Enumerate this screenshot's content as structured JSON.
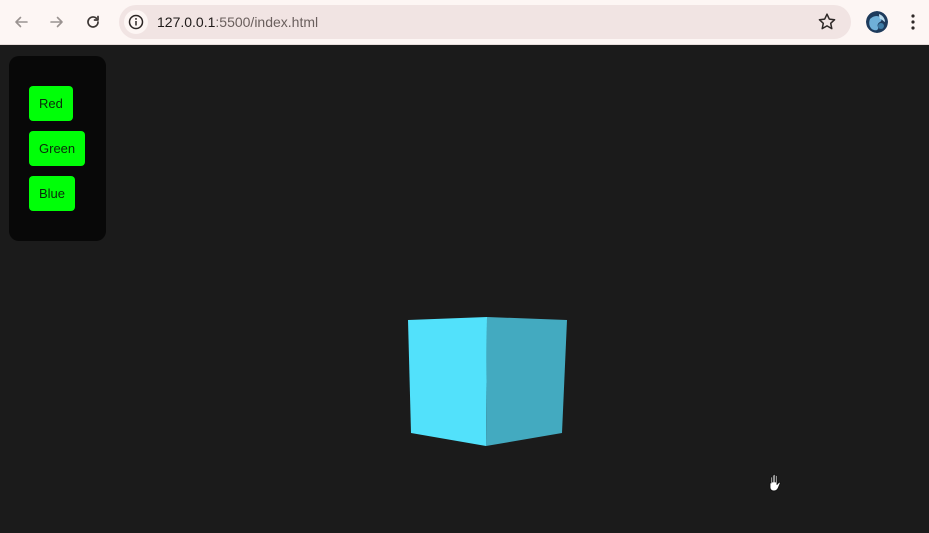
{
  "browser": {
    "url_host": "127.0.0.1",
    "url_path": ":5500/index.html",
    "back_icon": "back-arrow-icon",
    "forward_icon": "forward-arrow-icon",
    "reload_icon": "reload-icon",
    "site_info_icon": "info-icon",
    "bookmark_icon": "star-icon",
    "profile_icon": "avatar",
    "menu_icon": "vertical-dots-icon"
  },
  "panel": {
    "buttons": [
      {
        "label": "Red"
      },
      {
        "label": "Green"
      },
      {
        "label": "Blue"
      }
    ],
    "button_color": "#00ff08",
    "background": "#080808"
  },
  "scene": {
    "background": "#1b1b1b",
    "cube_front_color": "#52e1fb",
    "cube_side_color": "#43aac0",
    "cursor_icon": "grab-hand-icon"
  }
}
